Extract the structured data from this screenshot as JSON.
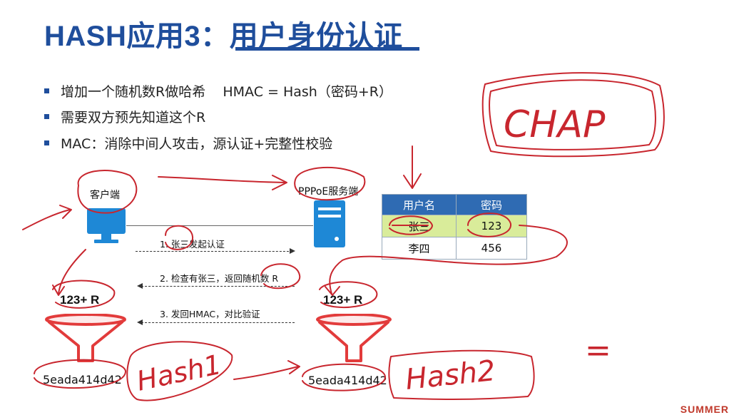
{
  "title": "HASH应用3：用户身份认证",
  "bullets": [
    "增加一个随机数R做哈希    HMAC = Hash（密码+R）",
    "需要双方预先知道这个R",
    "MAC：消除中间人攻击，源认证+完整性校验"
  ],
  "client": {
    "label": "客户端"
  },
  "server": {
    "label": "PPPoE服务端"
  },
  "table": {
    "headers": [
      "用户名",
      "密码"
    ],
    "rows": [
      [
        "张三",
        "123"
      ],
      [
        "李四",
        "456"
      ]
    ]
  },
  "steps": [
    "1. 张三发起认证",
    "2. 检查有张三，返回随机数 R",
    "3. 发回HMAC，对比验证"
  ],
  "left_formula": "123+ R",
  "right_formula": "123+ R",
  "left_hash": "5eada414d42",
  "right_hash": "5eada414d42",
  "handwriting": {
    "chap": "CHAP",
    "hash1": "Hash1",
    "hash2": "Hash2",
    "equals": "="
  },
  "watermark": "SUMMER",
  "colors": {
    "title": "#1f4e9c",
    "ink": "#c8262e",
    "table_header": "#2f6bb3",
    "highlight_row": "#d9ec9a"
  }
}
